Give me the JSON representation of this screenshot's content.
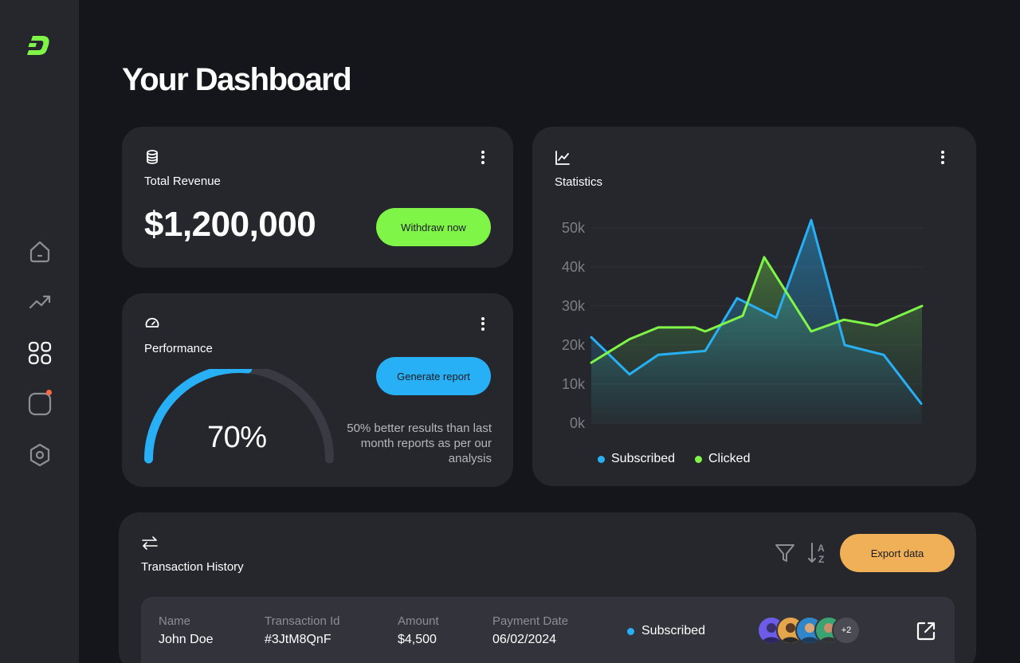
{
  "page": {
    "title": "Your Dashboard"
  },
  "sidebar": {
    "logo": "dash-logo",
    "items": [
      {
        "icon": "home-icon"
      },
      {
        "icon": "trending-icon"
      },
      {
        "icon": "grid-icon"
      },
      {
        "icon": "chat-icon",
        "has_notification": true
      },
      {
        "icon": "settings-hexagon-icon"
      }
    ]
  },
  "revenue": {
    "title": "Total Revenue",
    "value": "$1,200,000",
    "button": "Withdraw now",
    "icon": "database-icon"
  },
  "performance": {
    "title": "Performance",
    "icon": "gauge-icon",
    "percent_label": "70%",
    "percent": 70,
    "button": "Generate report",
    "note": "50% better results than last month reports as per our analysis"
  },
  "statistics": {
    "title": "Statistics",
    "icon": "chart-line-icon"
  },
  "chart_data": {
    "type": "area",
    "title": "",
    "xlabel": "",
    "ylabel": "",
    "yticks": [
      "0k",
      "10k",
      "20k",
      "30k",
      "40k",
      "50k"
    ],
    "ylim": [
      0,
      50000
    ],
    "grid": true,
    "legend_position": "bottom-left",
    "x": [
      0,
      1,
      2,
      3,
      4,
      5,
      6,
      7,
      8,
      9,
      10,
      11,
      12
    ],
    "series": [
      {
        "name": "Subscribed",
        "color": "#27b0f5",
        "values": [
          22000,
          12500,
          17500,
          18500,
          32000,
          27000,
          52000,
          20000,
          17500,
          5000
        ]
      },
      {
        "name": "Clicked",
        "color": "#7ff548",
        "values": [
          15500,
          21500,
          24500,
          24500,
          23500,
          27500,
          42500,
          23500,
          26500,
          25000,
          30000
        ]
      }
    ]
  },
  "transactions": {
    "title": "Transaction History",
    "export_label": "Export data",
    "columns": [
      "Name",
      "Transaction Id",
      "Amount",
      "Payment Date"
    ],
    "rows": [
      {
        "name": "John Doe",
        "id": "#3JtM8QnF",
        "amount": "$4,500",
        "date": "06/02/2024",
        "status": "Subscribed",
        "more_avatars": "+2"
      }
    ]
  },
  "colors": {
    "accent_green": "#7ff548",
    "accent_blue": "#27b0f5",
    "accent_orange": "#f0b057"
  }
}
